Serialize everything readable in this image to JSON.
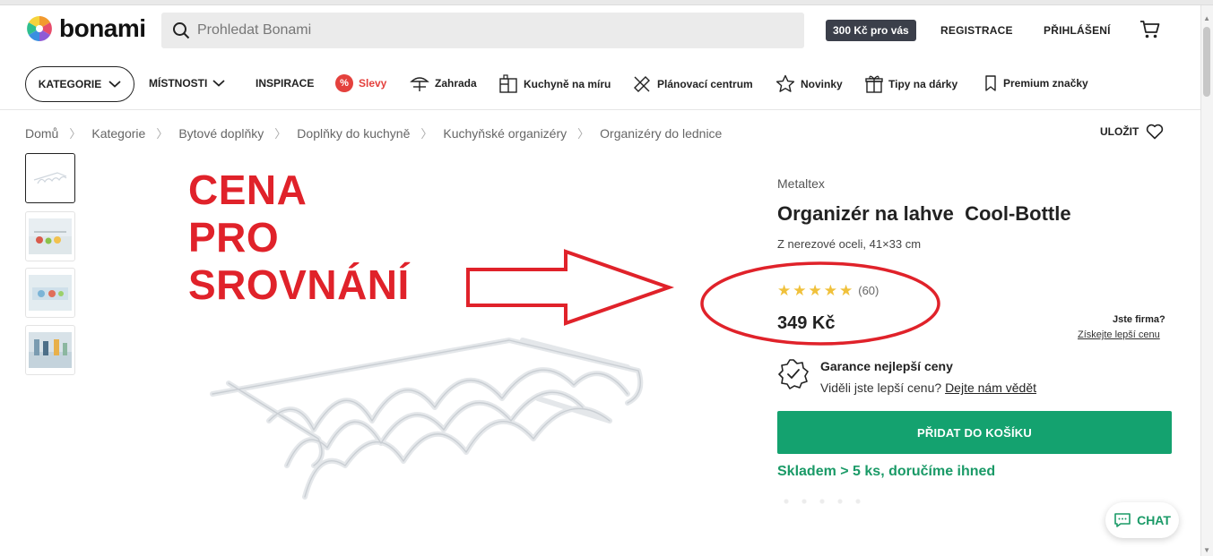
{
  "header": {
    "logo_text": "bonami",
    "search_placeholder": "Prohledat Bonami",
    "promo_badge": "300 Kč pro vás",
    "register": "REGISTRACE",
    "login": "PŘIHLÁŠENÍ"
  },
  "nav": {
    "kategorie": "KATEGORIE",
    "mistnosti": "MÍSTNOSTI",
    "inspirace": "INSPIRACE",
    "slevy": "Slevy",
    "zahrada": "Zahrada",
    "kuchyne": "Kuchyně na míru",
    "planovaci": "Plánovací centrum",
    "novinky": "Novinky",
    "tipy": "Tipy na dárky",
    "premium": "Premium značky"
  },
  "breadcrumb": [
    "Domů",
    "Kategorie",
    "Bytové doplňky",
    "Doplňky do kuchyně",
    "Kuchyňské organizéry",
    "Organizéry do lednice"
  ],
  "save_label": "ULOŽIT",
  "annotation": {
    "line1": "CENA",
    "line2": "PRO",
    "line3": "SROVNÁNÍ"
  },
  "product": {
    "brand": "Metaltex",
    "title": "Organizér na lahve  Cool-Bottle",
    "subtitle": "Z nerezové oceli, 41×33 cm",
    "rating_stars": 5,
    "rating_count": "(60)",
    "price": "349 Kč",
    "company_question": "Jste firma?",
    "company_link": "Získejte lepší cenu",
    "guarantee_title": "Garance nejlepší ceny",
    "guarantee_text": "Viděli jste lepší cenu?",
    "guarantee_link": "Dejte nám vědět",
    "add_to_cart": "PŘIDAT DO KOŠÍKU",
    "stock": "Skladem > 5 ks, doručíme ihned"
  },
  "chat_label": "CHAT",
  "colors": {
    "accent_green": "#14a26f",
    "sale_red": "#e4413d",
    "annotation_red": "#e0222a"
  }
}
